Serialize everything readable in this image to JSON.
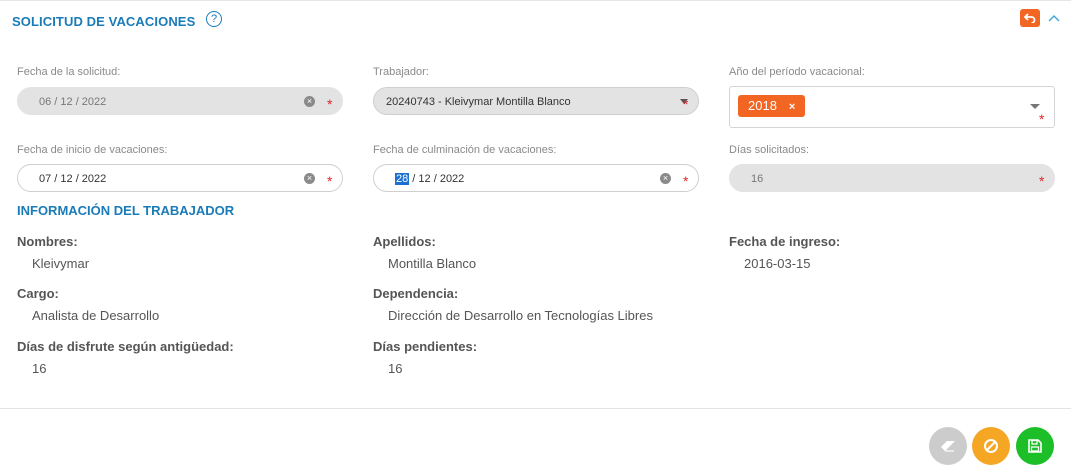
{
  "header": {
    "title": "SOLICITUD DE VACACIONES",
    "help": "?"
  },
  "form": {
    "fecha_solicitud": {
      "label": "Fecha de la solicitud:",
      "value": "06 / 12 / 2022"
    },
    "trabajador": {
      "label": "Trabajador:",
      "value": "20240743 - Kleivymar Montilla Blanco"
    },
    "anio_periodo": {
      "label": "Año del período vacacional:",
      "tag": "2018",
      "tag_remove": "×"
    },
    "fecha_inicio": {
      "label": "Fecha de inicio de vacaciones:",
      "value": "07 / 12 / 2022"
    },
    "fecha_culminacion": {
      "label": "Fecha de culminación de vacaciones:",
      "value_selected": "28",
      "value_rest": " / 12 / 2022"
    },
    "dias_solicitados": {
      "label": "Días solicitados:",
      "value": "16"
    },
    "required_mark": "*",
    "clear_mark": "×"
  },
  "info": {
    "section_title": "INFORMACIÓN DEL TRABAJADOR",
    "nombres": {
      "label": "Nombres:",
      "value": "Kleivymar"
    },
    "apellidos": {
      "label": "Apellidos:",
      "value": "Montilla Blanco"
    },
    "fecha_ingreso": {
      "label": "Fecha de ingreso:",
      "value": "2016-03-15"
    },
    "cargo": {
      "label": "Cargo:",
      "value": "Analista de Desarrollo"
    },
    "dependencia": {
      "label": "Dependencia:",
      "value": "Dirección de Desarrollo en Tecnologías Libres"
    },
    "dias_disfrute": {
      "label": "Días de disfrute según antigüedad:",
      "value": "16"
    },
    "dias_pendientes": {
      "label": "Días pendientes:",
      "value": "16"
    }
  },
  "colors": {
    "accent": "#1a7bb9",
    "tag": "#f26522",
    "required": "#e0262d",
    "save": "#1dbf29",
    "cancel": "#f5a623",
    "erase": "#cccccc"
  },
  "icons": [
    "help-icon",
    "undo-icon",
    "chevron-up-icon",
    "eraser-icon",
    "ban-icon",
    "save-icon"
  ]
}
